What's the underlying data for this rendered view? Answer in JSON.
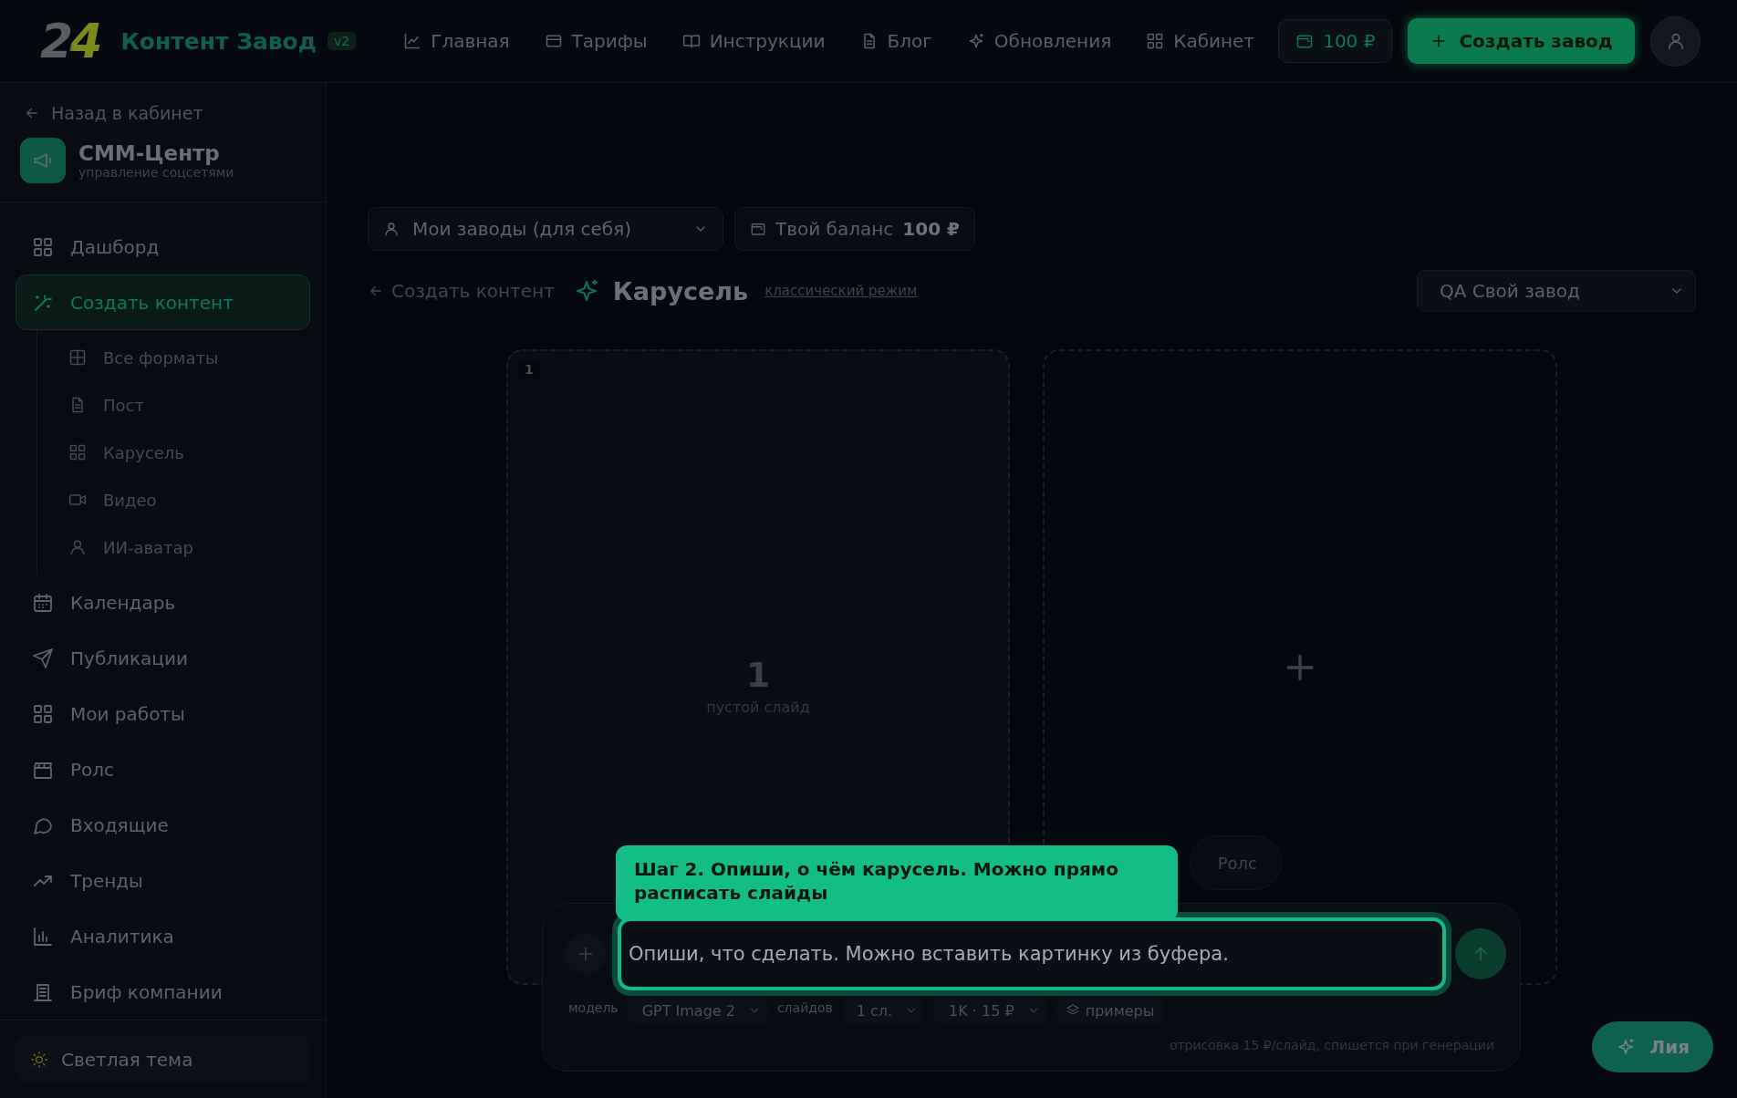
{
  "header": {
    "logo": "24",
    "title": "Контент Завод",
    "version": "v2",
    "nav": [
      {
        "label": "Главная"
      },
      {
        "label": "Тарифы"
      },
      {
        "label": "Инструкции"
      },
      {
        "label": "Блог"
      },
      {
        "label": "Обновления"
      },
      {
        "label": "Кабинет"
      }
    ],
    "balance": "100 ₽",
    "create_button": "Создать завод"
  },
  "sidebar": {
    "back": "Назад в кабинет",
    "brand": {
      "name": "СММ-Центр",
      "subtitle": "управление соцсетями"
    },
    "items": [
      {
        "label": "Дашборд",
        "selected": false
      },
      {
        "label": "Создать контент",
        "selected": true,
        "children": [
          {
            "label": "Все форматы",
            "selected": false
          },
          {
            "label": "Пост",
            "selected": false
          },
          {
            "label": "Карусель",
            "selected": false
          },
          {
            "label": "Видео",
            "selected": false
          },
          {
            "label": "ИИ-аватар",
            "selected": false
          }
        ]
      },
      {
        "label": "Календарь",
        "selected": false
      },
      {
        "label": "Публикации",
        "selected": false
      },
      {
        "label": "Мои работы",
        "selected": false
      },
      {
        "label": "Ролс",
        "selected": false
      },
      {
        "label": "Входящие",
        "selected": false
      },
      {
        "label": "Тренды",
        "selected": false
      },
      {
        "label": "Аналитика",
        "selected": false
      },
      {
        "label": "Бриф компании",
        "selected": false
      }
    ],
    "theme_toggle": "Светлая тема"
  },
  "toolbar": {
    "factory_select": "Мои заводы (для себя)",
    "balance_label": "Твой баланс",
    "balance_value": "100 ₽"
  },
  "breadcrumb": {
    "back": "Создать контент",
    "title": "Карусель",
    "mode_link": "классический режим",
    "factory": "QA Свой завод"
  },
  "slides": [
    {
      "kind": "slide",
      "badge": "1",
      "number": "1",
      "caption": "пустой слайд"
    },
    {
      "kind": "add"
    }
  ],
  "format_pills": [
    {
      "label": "Ролс"
    }
  ],
  "composer": {
    "placeholder": "Опиши, что сделать. Можно вставить картинку из буфера.",
    "model_label": "модель",
    "model": "GPT Image 2",
    "slides_label": "слайдов",
    "slides_count": "1 сл.",
    "quality": "1K · 15 ₽",
    "examples": "примеры",
    "note": "отрисовка 15 ₽/слайд, спишется при генерации"
  },
  "tour_tip": {
    "text": "Шаг 2. Опиши, о чём карусель. Можно прямо расписать слайды"
  },
  "assistant_button": "Лия"
}
